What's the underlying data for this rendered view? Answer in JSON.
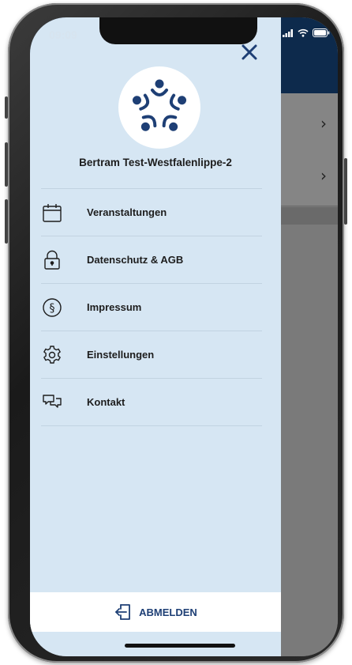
{
  "status_bar": {
    "time": "09:09"
  },
  "drawer": {
    "user_name": "Bertram Test-Westfalenlippe-2",
    "menu": [
      {
        "label": "Veranstaltungen",
        "icon": "calendar-icon"
      },
      {
        "label": "Datenschutz & AGB",
        "icon": "lock-icon"
      },
      {
        "label": "Impressum",
        "icon": "section-sign-icon"
      },
      {
        "label": "Einstellungen",
        "icon": "gear-icon"
      },
      {
        "label": "Kontakt",
        "icon": "chat-bubbles-icon"
      }
    ],
    "logout_label": "ABMELDEN"
  },
  "colors": {
    "drawer_bg": "#d6e6f3",
    "accent": "#1e3f75",
    "header_bg": "#0d2a4c"
  }
}
